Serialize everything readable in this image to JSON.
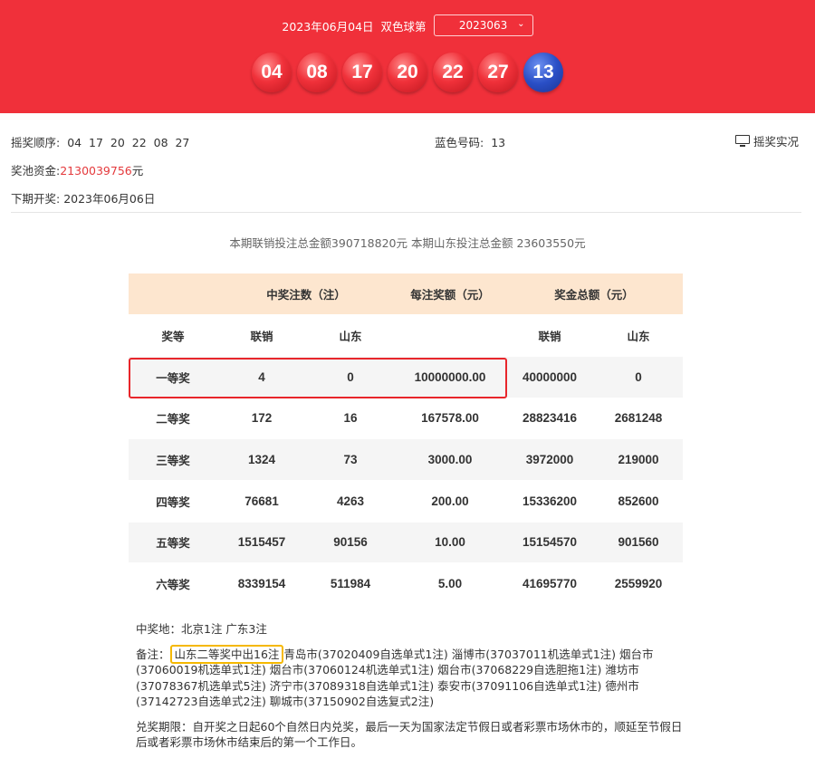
{
  "header": {
    "date_text": "2023年06月04日",
    "game_label": "双色球第",
    "issue_value": "2023063",
    "balls_red": [
      "04",
      "08",
      "17",
      "20",
      "22",
      "27"
    ],
    "ball_blue": "13"
  },
  "info": {
    "order_label": "摇奖顺序:",
    "order_values": "04  17  20  22  08  27",
    "blue_label": "蓝色号码:",
    "blue_value": "13",
    "pool_label": "奖池资金:",
    "pool_value": "2130039756",
    "pool_unit": "元",
    "next_label": "下期开奖:",
    "next_value": "2023年06月06日",
    "live_label": "摇奖实况"
  },
  "totals_text": "本期联销投注总金额390718820元 本期山东投注总金额 23603550元",
  "table": {
    "group_headers": [
      "中奖注数（注）",
      "每注奖额（元）",
      "奖金总额（元）"
    ],
    "sub_headers": [
      "奖等",
      "联销",
      "山东",
      "",
      "联销",
      "山东"
    ],
    "rows": [
      [
        "一等奖",
        "4",
        "0",
        "10000000.00",
        "40000000",
        "0"
      ],
      [
        "二等奖",
        "172",
        "16",
        "167578.00",
        "28823416",
        "2681248"
      ],
      [
        "三等奖",
        "1324",
        "73",
        "3000.00",
        "3972000",
        "219000"
      ],
      [
        "四等奖",
        "76681",
        "4263",
        "200.00",
        "15336200",
        "852600"
      ],
      [
        "五等奖",
        "1515457",
        "90156",
        "10.00",
        "15154570",
        "901560"
      ],
      [
        "六等奖",
        "8339154",
        "511984",
        "5.00",
        "41695770",
        "2559920"
      ]
    ]
  },
  "notes": {
    "winners_line": "中奖地：北京1注 广东3注",
    "remark_label": "备注：",
    "remark_highlight": "山东二等奖中出16注",
    "remark_rest": "青岛市(37020409自选单式1注) 淄博市(37037011机选单式1注) 烟台市(37060019机选单式1注) 烟台市(37060124机选单式1注) 烟台市(37068229自选胆拖1注) 潍坊市(37078367机选单式5注) 济宁市(37089318自选单式1注) 泰安市(37091106自选单式1注) 德州市(37142723自选单式2注) 聊城市(37150902自选复式2注)",
    "redeem_text": "兑奖期限：自开奖之日起60个自然日内兑奖，最后一天为国家法定节假日或者彩票市场休市的，顺延至节假日后或者彩票市场休市结束后的第一个工作日。"
  },
  "colors": {
    "banner": "#f0303a",
    "red_text": "#e4393c",
    "header_fill": "#fde6cf",
    "highlight_red": "#e8262b",
    "highlight_yellow": "#f5b800",
    "blue_ball": "#2a4fc6"
  },
  "icons": {
    "live": "monitor-icon",
    "dropdown": "chevron-down-icon"
  }
}
